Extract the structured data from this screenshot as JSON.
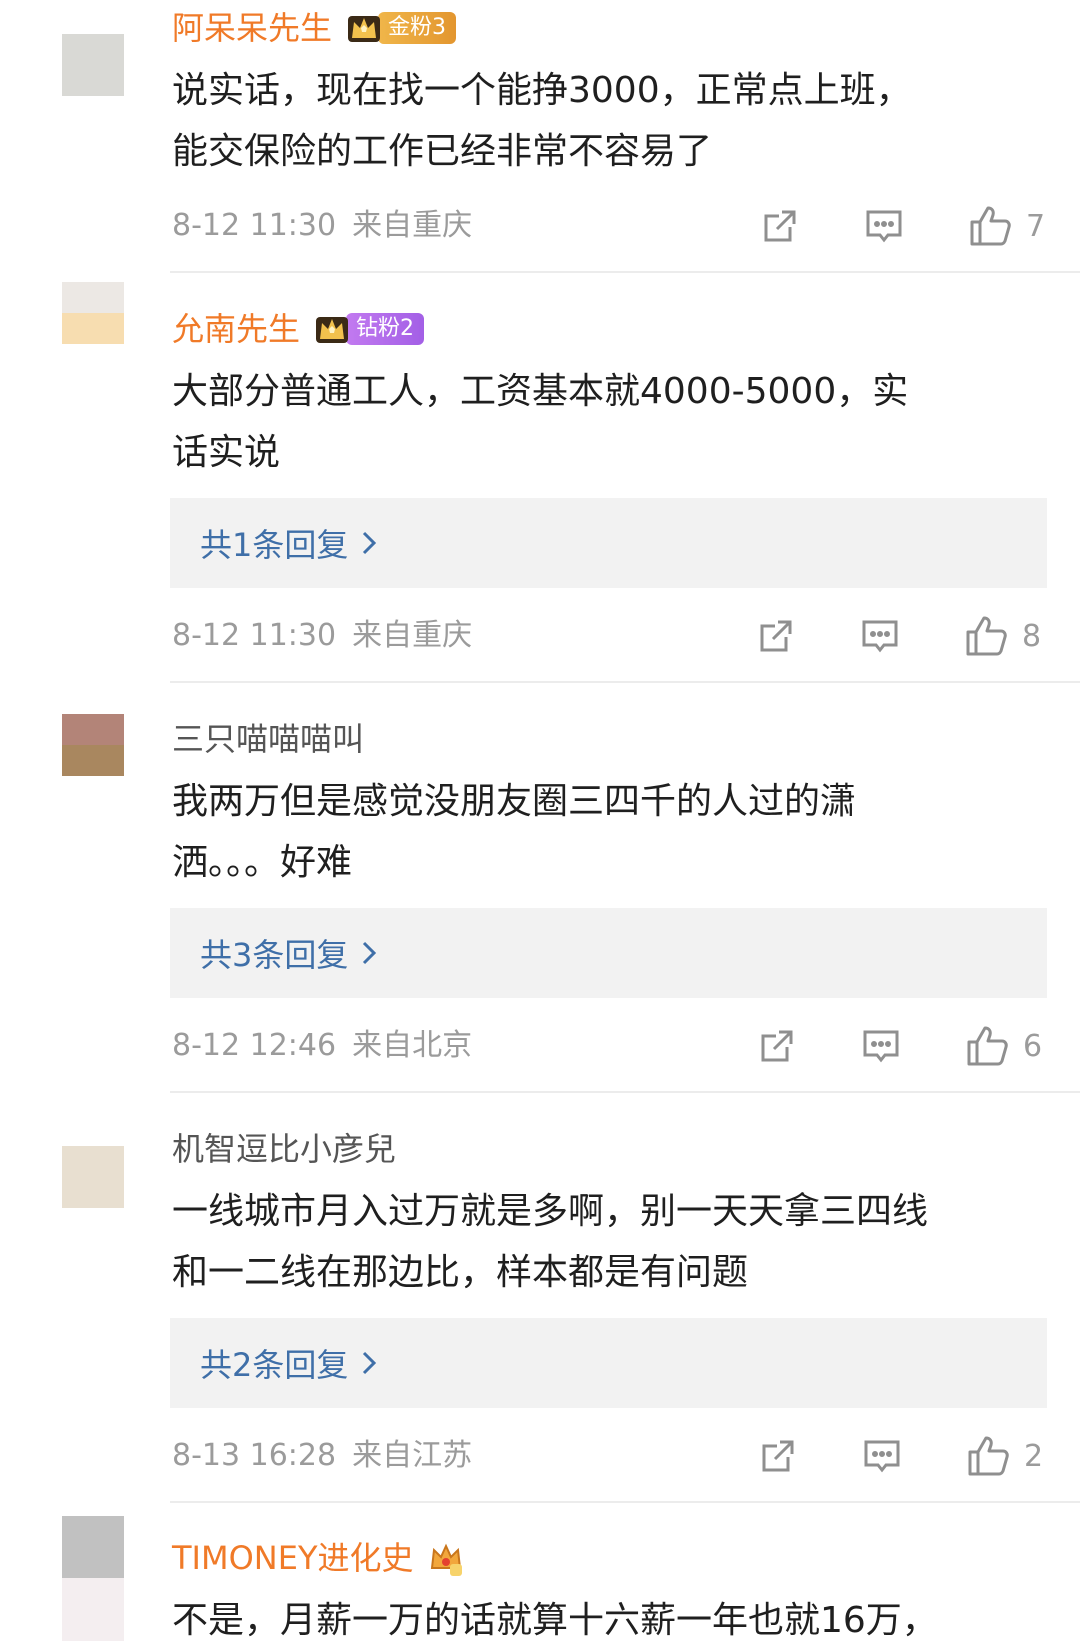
{
  "comments": [
    {
      "username": "阿呆呆先生",
      "badge": "金粉3",
      "text": "说实话，现在找一个能挣3000，正常点上班，\n能交保险的工作已经非常不容易了",
      "date": "8-12 11:30",
      "location": "来自重庆",
      "likes": "7",
      "avatar_colors": [
        "#d9d9d5",
        "#d9d9d5"
      ]
    },
    {
      "username": "允南先生",
      "badge": "钻粉2",
      "text": "大部分普通工人，工资基本就4000-5000，实\n话实说",
      "replies": "共1条回复",
      "date": "8-12 11:30",
      "location": "来自重庆",
      "likes": "8",
      "avatar_colors": [
        "#ece8e4",
        "#f7ddb0"
      ]
    },
    {
      "username": "三只喵喵喵叫",
      "text": "我两万但是感觉没朋友圈三四千的人过的潇\n洒。。。好难",
      "replies": "共3条回复",
      "date": "8-12 12:46",
      "location": "来自北京",
      "likes": "6",
      "avatar_colors": [
        "#b38478",
        "#a9875f"
      ]
    },
    {
      "username": "机智逗比小彦兒",
      "text": "一线城市月入过万就是多啊，别一天天拿三四线\n和一二线在那边比，样本都是有问题",
      "replies": "共2条回复",
      "date": "8-13 16:28",
      "location": "来自江苏",
      "likes": "2",
      "avatar_colors": [
        "#e8dfd0",
        "#e8dfd0"
      ]
    },
    {
      "username": "TIMONEY进化史",
      "text": "不是，月薪一万的话就算十六薪一年也就16万，",
      "avatar_colors": [
        "#c1c1c1",
        "#f4eef0"
      ]
    }
  ],
  "icons": {
    "share": "share-icon",
    "comment": "comment-icon",
    "like": "thumbs-up-icon",
    "reply_arrow": "chevron-right-icon",
    "crown": "crown-icon"
  },
  "colors": {
    "vip_name": "#f07a28",
    "plain_name": "#555555",
    "reply_link": "#3f6fa8",
    "meta": "#9b9b9b",
    "gold_badge": "#e8a53c",
    "diamond_badge": "#b16ce9"
  }
}
